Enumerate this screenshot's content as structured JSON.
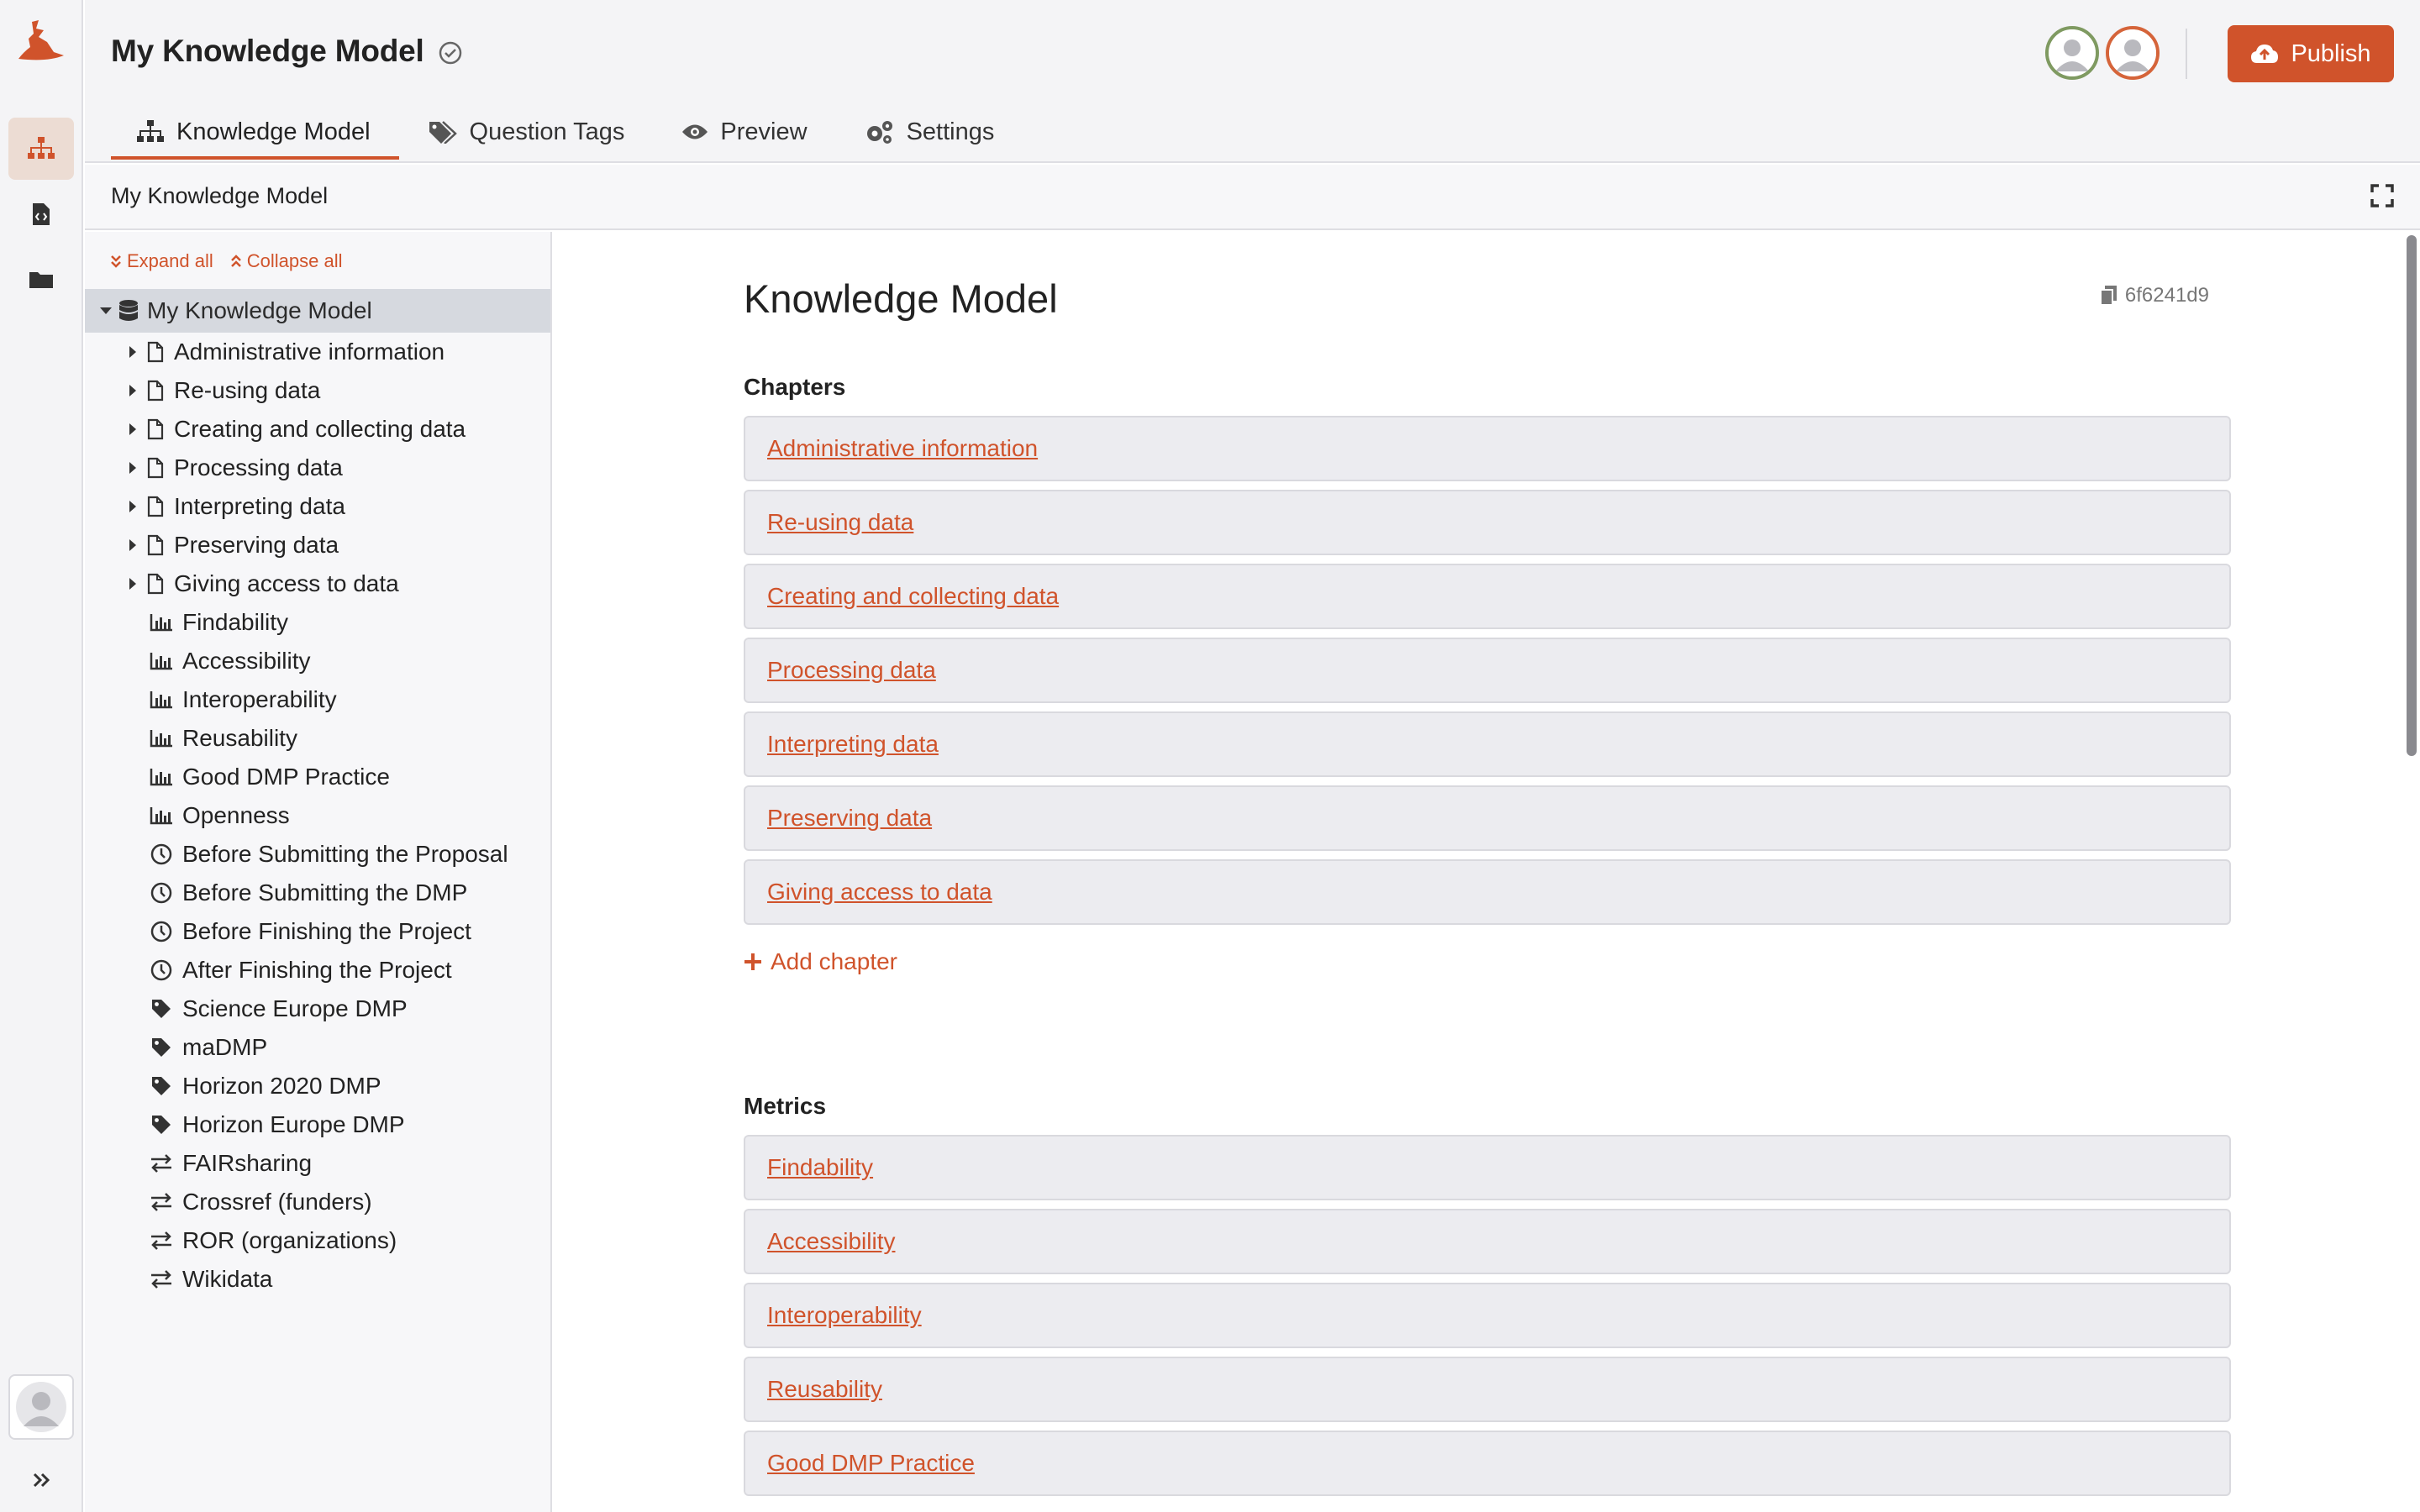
{
  "colors": {
    "accent": "#d0532b",
    "active_nav_bg": "#ecdcd3",
    "card_bg": "#ececf0"
  },
  "header": {
    "title": "My Knowledge Model",
    "publish_label": "Publish",
    "tabs": [
      {
        "label": "Knowledge Model",
        "icon": "sitemap-icon",
        "active": true
      },
      {
        "label": "Question Tags",
        "icon": "tags-icon",
        "active": false
      },
      {
        "label": "Preview",
        "icon": "eye-icon",
        "active": false
      },
      {
        "label": "Settings",
        "icon": "cogs-icon",
        "active": false
      }
    ]
  },
  "breadcrumb": {
    "text": "My Knowledge Model"
  },
  "tree": {
    "expand_all": "Expand all",
    "collapse_all": "Collapse all",
    "root": "My Knowledge Model",
    "chapters": [
      "Administrative information",
      "Re-using data",
      "Creating and collecting data",
      "Processing data",
      "Interpreting data",
      "Preserving data",
      "Giving access to data"
    ],
    "metrics": [
      "Findability",
      "Accessibility",
      "Interoperability",
      "Reusability",
      "Good DMP Practice",
      "Openness"
    ],
    "phases": [
      "Before Submitting the Proposal",
      "Before Submitting the DMP",
      "Before Finishing the Project",
      "After Finishing the Project"
    ],
    "tags": [
      "Science Europe DMP",
      "maDMP",
      "Horizon 2020 DMP",
      "Horizon Europe DMP"
    ],
    "integrations": [
      "FAIRsharing",
      "Crossref (funders)",
      "ROR (organizations)",
      "Wikidata"
    ]
  },
  "main": {
    "title": "Knowledge Model",
    "uuid": "6f6241d9",
    "chapters_heading": "Chapters",
    "chapters": [
      "Administrative information",
      "Re-using data",
      "Creating and collecting data",
      "Processing data",
      "Interpreting data",
      "Preserving data",
      "Giving access to data"
    ],
    "add_chapter": "Add chapter",
    "metrics_heading": "Metrics",
    "metrics": [
      "Findability",
      "Accessibility",
      "Interoperability",
      "Reusability",
      "Good DMP Practice"
    ]
  }
}
